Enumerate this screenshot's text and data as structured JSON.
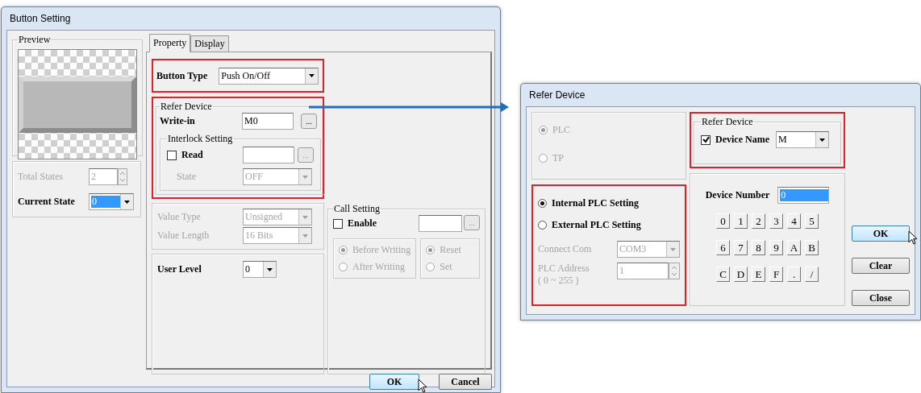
{
  "button_setting": {
    "title": "Button Setting",
    "preview": {
      "legend": "Preview"
    },
    "total_states": {
      "label": "Total States",
      "value": "2",
      "disabled": true
    },
    "current_state": {
      "label": "Current State",
      "value": "0",
      "value_selected": true
    },
    "tabs": [
      {
        "label": "Property",
        "selected": true
      },
      {
        "label": "Display",
        "selected": false
      }
    ],
    "button_type": {
      "label": "Button Type",
      "value": "Push On/Off",
      "highlighted": true
    },
    "refer_device": {
      "legend": "Refer Device",
      "highlighted": true,
      "write_in": {
        "label": "Write-in",
        "value": "M0",
        "browse": "..."
      },
      "interlock": {
        "legend": "Interlock Setting",
        "read": {
          "label": "Read",
          "checked": false,
          "browse": "..."
        },
        "state": {
          "label": "State",
          "value": "OFF",
          "disabled": true
        }
      }
    },
    "value_type": {
      "label": "Value Type",
      "value": "Unsigned",
      "disabled": true
    },
    "value_length": {
      "label": "Value Length",
      "value": "16 Bits",
      "disabled": true
    },
    "user_level": {
      "label": "User Level",
      "value": "0"
    },
    "call_setting": {
      "legend": "Call Setting",
      "enable": {
        "label": "Enable",
        "checked": false
      },
      "browse": "...",
      "timing": [
        {
          "label": "Before Writing",
          "selected": true
        },
        {
          "label": "After Writing",
          "selected": false
        }
      ],
      "action": [
        {
          "label": "Reset",
          "selected": true
        },
        {
          "label": "Set",
          "selected": false
        }
      ]
    },
    "buttons": [
      {
        "label": "OK",
        "kind": "default"
      },
      {
        "label": "Cancel",
        "kind": "normal"
      }
    ]
  },
  "refer_device": {
    "title": "Refer Device",
    "target": [
      {
        "label": "PLC",
        "selected": true
      },
      {
        "label": "TP",
        "selected": false
      }
    ],
    "plc_setting": {
      "highlighted": true,
      "options": [
        {
          "label": "Internal PLC Setting",
          "selected": true
        },
        {
          "label": "External PLC Setting",
          "selected": false
        }
      ],
      "connect_com": {
        "label": "Connect Com",
        "value": "COM3",
        "disabled": true
      },
      "plc_address": {
        "label": "PLC Address",
        "range": "( 0 ~ 255 )",
        "value": "1",
        "disabled": true
      }
    },
    "device_group": {
      "legend": "Refer Device",
      "highlighted": true,
      "device_name": {
        "label": "Device Name",
        "checked": true,
        "value": "M"
      }
    },
    "device_number": {
      "label": "Device Number",
      "value": "0",
      "value_selected": true
    },
    "keypad": [
      "0",
      "1",
      "2",
      "3",
      "4",
      "5",
      "6",
      "7",
      "8",
      "9",
      "A",
      "B",
      "C",
      "D",
      "E",
      "F",
      ".",
      "/"
    ],
    "buttons": [
      {
        "label": "OK",
        "kind": "default"
      },
      {
        "label": "Clear",
        "kind": "normal"
      },
      {
        "label": "Close",
        "kind": "normal"
      }
    ]
  }
}
